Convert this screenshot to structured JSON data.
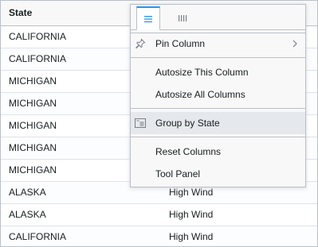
{
  "grid": {
    "header": {
      "state_label": "State"
    },
    "rows": [
      {
        "state": "CALIFORNIA",
        "type": ""
      },
      {
        "state": "CALIFORNIA",
        "type": ""
      },
      {
        "state": "MICHIGAN",
        "type": ""
      },
      {
        "state": "MICHIGAN",
        "type": ""
      },
      {
        "state": "MICHIGAN",
        "type": ""
      },
      {
        "state": "MICHIGAN",
        "type": ""
      },
      {
        "state": "MICHIGAN",
        "type": ""
      },
      {
        "state": "ALASKA",
        "type": "High Wind"
      },
      {
        "state": "ALASKA",
        "type": "High Wind"
      },
      {
        "state": "CALIFORNIA",
        "type": "High Wind"
      }
    ]
  },
  "column_menu": {
    "tabs": [
      {
        "icon": "menu-icon",
        "active": true
      },
      {
        "icon": "columns-icon",
        "active": false
      }
    ],
    "items": {
      "pin_column": "Pin Column",
      "autosize_this": "Autosize This Column",
      "autosize_all": "Autosize All Columns",
      "group_by": "Group by State",
      "reset_columns": "Reset Columns",
      "tool_panel": "Tool Panel"
    },
    "accent_color": "#2196f3"
  }
}
